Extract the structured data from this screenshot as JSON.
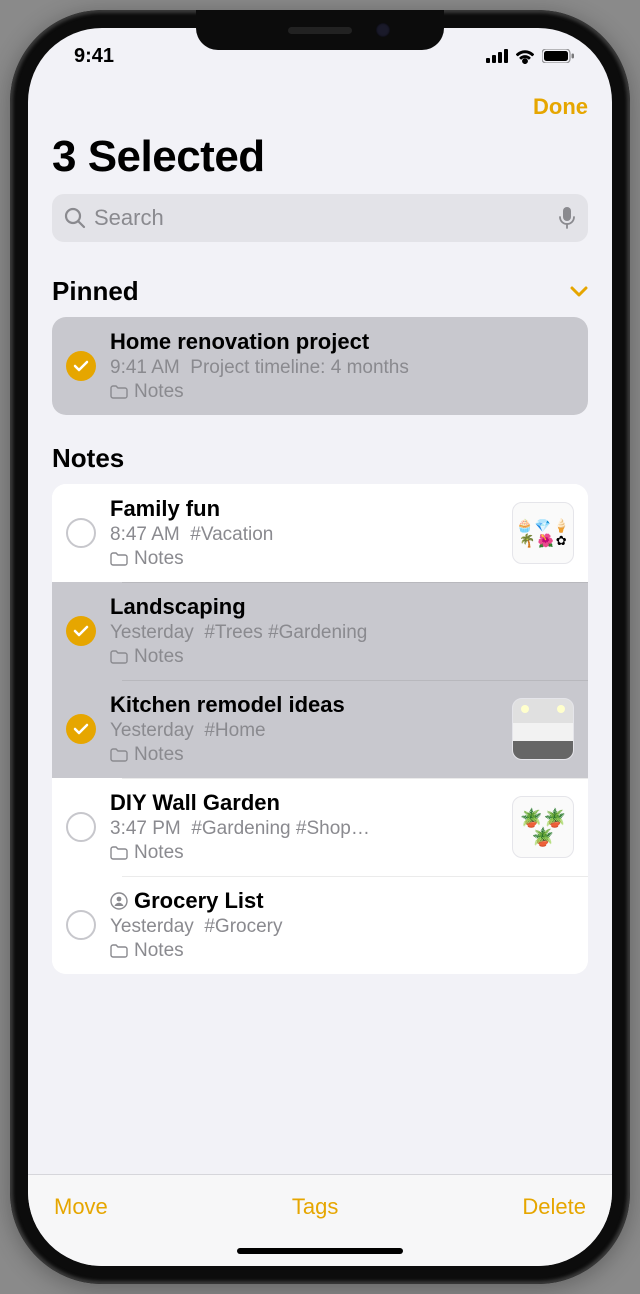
{
  "status": {
    "time": "9:41"
  },
  "nav": {
    "done": "Done"
  },
  "page_title": "3 Selected",
  "search": {
    "placeholder": "Search"
  },
  "sections": {
    "pinned_label": "Pinned",
    "notes_label": "Notes"
  },
  "pinned": [
    {
      "title": "Home renovation project",
      "time": "9:41 AM",
      "preview": "Project timeline: 4 months",
      "folder": "Notes",
      "selected": true
    }
  ],
  "notes": [
    {
      "title": "Family fun",
      "time": "8:47 AM",
      "preview": "#Vacation",
      "folder": "Notes",
      "selected": false,
      "thumb": "fun"
    },
    {
      "title": "Landscaping",
      "time": "Yesterday",
      "preview": "#Trees #Gardening",
      "folder": "Notes",
      "selected": true
    },
    {
      "title": "Kitchen remodel ideas",
      "time": "Yesterday",
      "preview": "#Home",
      "folder": "Notes",
      "selected": true,
      "thumb": "kitchen"
    },
    {
      "title": "DIY Wall Garden",
      "time": "3:47 PM",
      "preview": "#Gardening #Shop…",
      "folder": "Notes",
      "selected": false,
      "thumb": "plants"
    },
    {
      "title": "Grocery List",
      "time": "Yesterday",
      "preview": "#Grocery",
      "folder": "Notes",
      "selected": false,
      "shared": true
    }
  ],
  "toolbar": {
    "move": "Move",
    "tags": "Tags",
    "delete": "Delete"
  },
  "colors": {
    "accent": "#e6a600"
  }
}
